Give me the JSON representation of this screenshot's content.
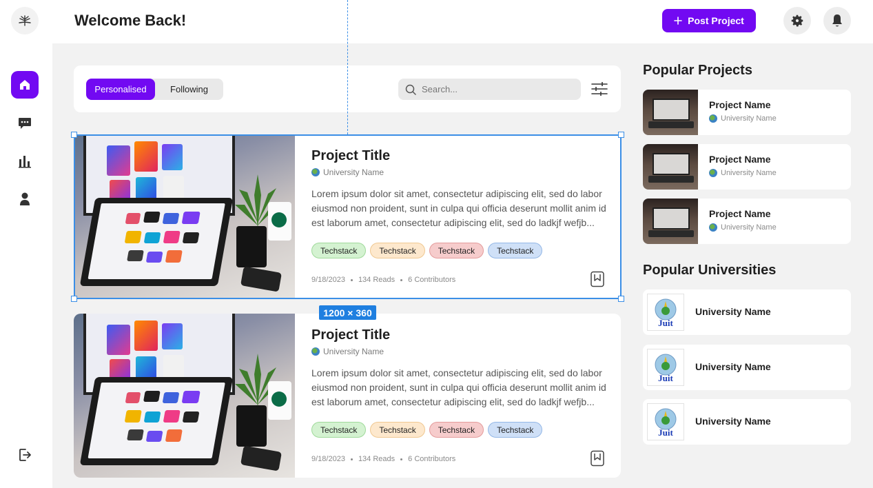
{
  "header": {
    "title": "Welcome Back!",
    "post_button_label": "Post Project",
    "post_button_icon": "plus-icon",
    "settings_icon": "gear-icon",
    "notification_icon": "bell-icon"
  },
  "sidebar": {
    "logo_icon": "fern-logo-icon",
    "items": [
      {
        "name": "home",
        "icon": "home-icon",
        "active": true
      },
      {
        "name": "messages",
        "icon": "chat-icon",
        "active": false
      },
      {
        "name": "stats",
        "icon": "bar-chart-icon",
        "active": false
      },
      {
        "name": "profile",
        "icon": "user-icon",
        "active": false
      }
    ],
    "logout_icon": "logout-icon"
  },
  "filters": {
    "tabs": [
      {
        "label": "Personalised",
        "active": true
      },
      {
        "label": "Following",
        "active": false
      }
    ],
    "search_placeholder": "Search...",
    "filter_icon": "sliders-icon"
  },
  "feed": [
    {
      "title": "Project Title",
      "university": "University Name",
      "description": "Lorem ipsum dolor sit amet, consectetur adipiscing elit, sed do labor eiusmod non proident, sunt in culpa qui officia deserunt mollit anim id est laborum amet, consectetur adipiscing elit, sed do ladkjf wefjb...",
      "tags": [
        "Techstack",
        "Techstack",
        "Techstack",
        "Techstack"
      ],
      "date": "9/18/2023",
      "reads": "134 Reads",
      "contributors": "6 Contributors"
    },
    {
      "title": "Project Title",
      "university": "University Name",
      "description": "Lorem ipsum dolor sit amet, consectetur adipiscing elit, sed do labor eiusmod non proident, sunt in culpa qui officia deserunt mollit anim id est laborum amet, consectetur adipiscing elit, sed do ladkjf wefjb...",
      "tags": [
        "Techstack",
        "Techstack",
        "Techstack",
        "Techstack"
      ],
      "date": "9/18/2023",
      "reads": "134 Reads",
      "contributors": "6 Contributors"
    }
  ],
  "selection_overlay": {
    "dimension_label": "1200 × 360"
  },
  "popular_projects": {
    "title": "Popular Projects",
    "items": [
      {
        "name": "Project Name",
        "university": "University Name"
      },
      {
        "name": "Project Name",
        "university": "University Name"
      },
      {
        "name": "Project Name",
        "university": "University Name"
      }
    ]
  },
  "popular_universities": {
    "title": "Popular Universities",
    "items": [
      {
        "name": "University Name",
        "logo_text": "Juit"
      },
      {
        "name": "University Name",
        "logo_text": "Juit"
      },
      {
        "name": "University Name",
        "logo_text": "Juit"
      }
    ]
  },
  "colors": {
    "accent": "#7209f2",
    "selection": "#3a8ee6",
    "background": "#f2f2f2"
  }
}
